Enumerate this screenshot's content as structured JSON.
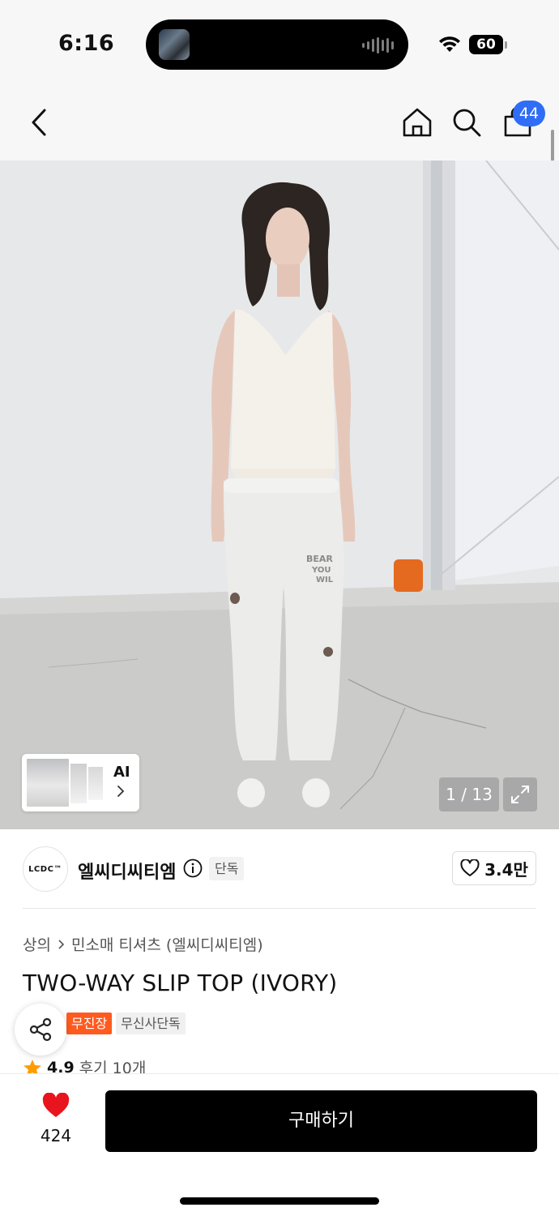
{
  "status_bar": {
    "time": "6:16",
    "battery": "60"
  },
  "header": {
    "cart_count": "44"
  },
  "gallery": {
    "counter": "1 / 13",
    "ai_label": "AI"
  },
  "brand": {
    "logo_text": "LCDC™",
    "name": "엘씨디씨티엠",
    "exclusive_badge": "단독",
    "likes": "3.4만"
  },
  "product": {
    "breadcrumb": [
      "상의",
      "민소매 티셔츠 (엘씨디씨티엠)"
    ],
    "title": "TWO-WAY SLIP TOP (IVORY)",
    "tags": [
      "무진장",
      "무신사단독"
    ],
    "rating": "4.9",
    "reviews": "후기 10개"
  },
  "bottom_bar": {
    "heart_count": "424",
    "buy_label": "구매하기"
  },
  "colors": {
    "accent_blue": "#2f6df6",
    "tag_orange": "#ff5a1f",
    "heart_red": "#e8141e",
    "star_orange": "#ff9d00"
  }
}
